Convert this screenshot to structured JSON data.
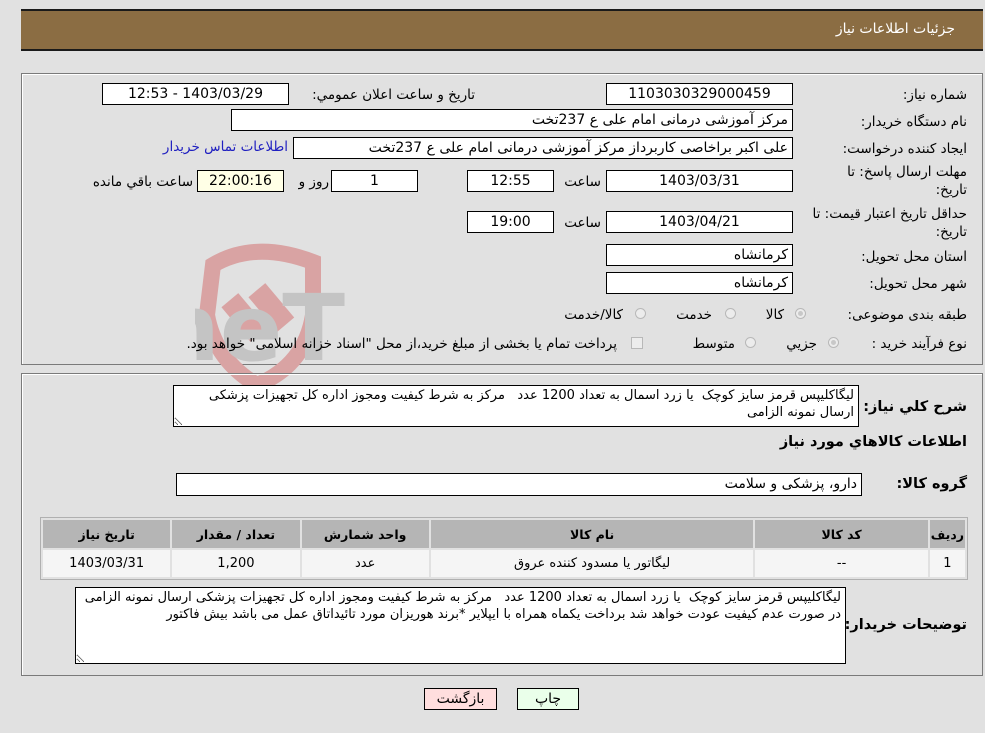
{
  "header": {
    "title": "جزئیات اطلاعات نیاز"
  },
  "form": {
    "need_number": {
      "label": "شماره نیاز:",
      "value": "1103030329000459"
    },
    "announce_datetime": {
      "label": "تاریخ و ساعت اعلان عمومي:",
      "value": "1403/03/29 - 12:53"
    },
    "buyer_org": {
      "label": "نام دستگاه خریدار:",
      "value": "مرکز آموزشی درمانی امام علی ع 237تخت"
    },
    "requester": {
      "label": "ایجاد کننده درخواست:",
      "value": "علی اکبر براخاصی کاربرداز  مرکز آموزشی درمانی امام علی ع 237تخت",
      "contact_link": "اطلاعات تماس خریدار"
    },
    "response_deadline": {
      "label_line1": "مهلت ارسال پاسخ: تا",
      "label_line2": "تاریخ:",
      "date": "1403/03/31",
      "time_label": "ساعت",
      "time": "12:55",
      "days": "1",
      "days_label": "روز و",
      "remaining": "22:00:16",
      "remaining_label": "ساعت باقي مانده"
    },
    "price_validity": {
      "label_line1": "حداقل تاریخ اعتبار قیمت: تا",
      "label_line2": "تاریخ:",
      "date": "1403/04/21",
      "time_label": "ساعت",
      "time": "19:00"
    },
    "delivery_province": {
      "label": "استان محل تحویل:",
      "value": "کرمانشاه"
    },
    "delivery_city": {
      "label": "شهر محل تحویل:",
      "value": "کرمانشاه"
    },
    "category": {
      "label": "طبقه بندی موضوعی:",
      "options": [
        "کالا",
        "خدمت",
        "کالا/خدمت"
      ],
      "selected": "کالا"
    },
    "purchase_type": {
      "label": "نوع فرآیند خرید :",
      "options": [
        "جزيي",
        "متوسط"
      ],
      "selected": "جزيي",
      "payment_note": "پرداخت تمام یا بخشی از مبلغ خرید،از محل \"اسناد خزانه اسلامی\" خواهد بود."
    }
  },
  "details": {
    "description_label": "شرح كلي نياز:",
    "description": "لیگاکلیپس قرمز سایز کوچک  یا زرد اسمال به تعداد 1200 عدد   مرکز به شرط کیفیت ومجوز اداره کل تجهیزات پزشکی ارسال نمونه الزامی",
    "items_heading": "اطلاعات كالاهاي مورد نياز",
    "goods_group_label": "گروه کالا:",
    "goods_group": "دارو، پزشکی و سلامت",
    "table": {
      "headers": [
        "ردیف",
        "کد کالا",
        "نام کالا",
        "واحد شمارش",
        "تعداد / مقدار",
        "تاریخ نیاز"
      ],
      "rows": [
        [
          "1",
          "--",
          "لیگاتور یا مسدود کننده عروق",
          "عدد",
          "1,200",
          "1403/03/31"
        ]
      ]
    },
    "buyer_notes_label": "توضیحات خریدار:",
    "buyer_notes": "لیگاکلیپس قرمز سایز کوچک  یا زرد اسمال به تعداد 1200 عدد   مرکز به شرط کیفیت ومجوز اداره کل تجهیزات پزشکی ارسال نمونه الزامی در صورت عدم کیفیت عودت خواهد شد برداخت یکماه همراه با ایپلایر *برند هوریزان مورد تائیداتاق عمل می باشد بیش فاکتور"
  },
  "buttons": {
    "print": "چاپ",
    "back": "بازگشت"
  },
  "colors": {
    "header_bg": "#8b6d43",
    "print_bg": "#eaffea",
    "back_bg": "#ffdede",
    "link": "#2020c0"
  },
  "watermark": {
    "text": "AriaTender.neT"
  }
}
